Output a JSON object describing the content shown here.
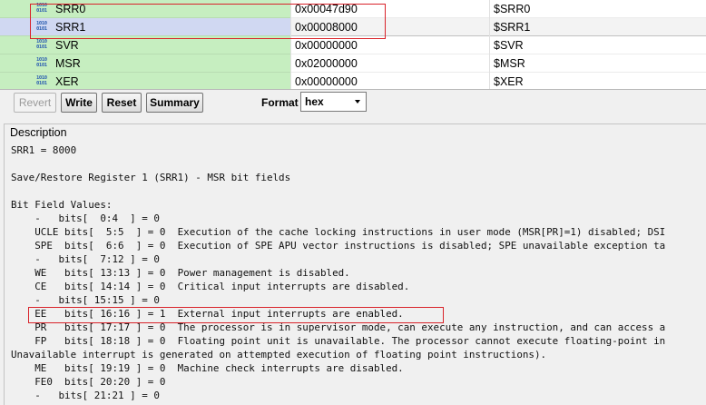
{
  "registers": [
    {
      "icon": "register-icon",
      "name": "SRR0",
      "value": "0x00047d90",
      "expr": "$SRR0"
    },
    {
      "icon": "register-icon",
      "name": "SRR1",
      "value": "0x00008000",
      "expr": "$SRR1",
      "selected": true
    },
    {
      "icon": "register-icon",
      "name": "SVR",
      "value": "0x00000000",
      "expr": "$SVR"
    },
    {
      "icon": "register-icon",
      "name": "MSR",
      "value": "0x02000000",
      "expr": "$MSR"
    },
    {
      "icon": "register-icon",
      "name": "XER",
      "value": "0x00000000",
      "expr": "$XER"
    }
  ],
  "toolbar": {
    "revert_label": "Revert",
    "write_label": "Write",
    "reset_label": "Reset",
    "summary_label": "Summary",
    "format_label": "Format",
    "format_value": "hex"
  },
  "description": {
    "legend": "Description",
    "lines": [
      "SRR1 = 8000",
      "",
      "Save/Restore Register 1 (SRR1) - MSR bit fields",
      "",
      "Bit Field Values:",
      "    -   bits[  0:4  ] = 0",
      "    UCLE bits[  5:5  ] = 0  Execution of the cache locking instructions in user mode (MSR[PR]=1) disabled; DSI",
      "    SPE  bits[  6:6  ] = 0  Execution of SPE APU vector instructions is disabled; SPE unavailable exception ta",
      "    -   bits[  7:12 ] = 0",
      "    WE   bits[ 13:13 ] = 0  Power management is disabled.",
      "    CE   bits[ 14:14 ] = 0  Critical input interrupts are disabled.",
      "    -   bits[ 15:15 ] = 0",
      "    EE   bits[ 16:16 ] = 1  External input interrupts are enabled.",
      "    PR   bits[ 17:17 ] = 0  The processor is in supervisor mode, can execute any instruction, and can access a",
      "    FP   bits[ 18:18 ] = 0  Floating point unit is unavailable. The processor cannot execute floating-point in",
      "Unavailable interrupt is generated on attempted execution of floating point instructions).",
      "    ME   bits[ 19:19 ] = 0  Machine check interrupts are disabled.",
      "    FE0  bits[ 20:20 ] = 0",
      "    -   bits[ 21:21 ] = 0"
    ]
  },
  "colors": {
    "register_name_bg": "#c6eec0",
    "highlight": "#d9232a"
  }
}
